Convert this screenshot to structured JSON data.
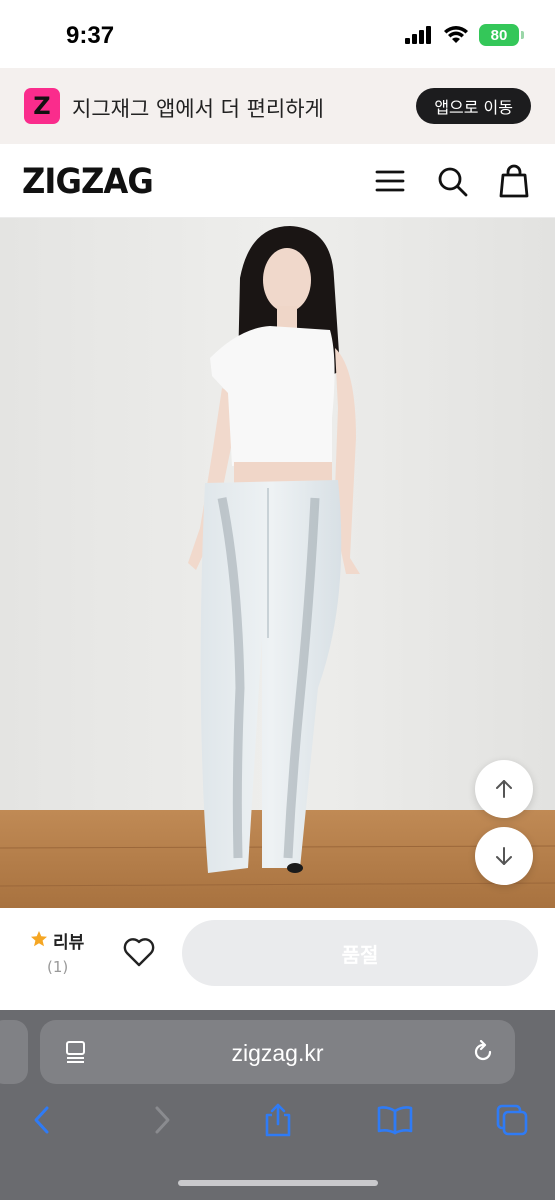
{
  "status_bar": {
    "time": "9:37",
    "battery": "80"
  },
  "app_banner": {
    "logo_letter": "Z",
    "text": "지그재그 앱에서 더 편리하게",
    "button_label": "앱으로 이동"
  },
  "header": {
    "logo": "ZIGZAG",
    "icons": [
      "menu-icon",
      "search-icon",
      "shopping-bag-icon"
    ]
  },
  "product": {
    "image": "fashion model photo",
    "scroll_buttons": [
      "arrow-up-icon",
      "arrow-down-icon"
    ]
  },
  "purchase_bar": {
    "review_label": "리뷰",
    "review_count": "(1)",
    "buy_button_label": "품절"
  },
  "browser": {
    "url": "zigzag.kr",
    "toolbar": [
      "back-icon",
      "forward-icon",
      "share-icon",
      "bookmarks-icon",
      "tabs-icon"
    ]
  },
  "colors": {
    "brand_pink": "#fa2c8c",
    "battery_green": "#34c759",
    "safari_blue": "#2f7bf5",
    "star": "#f5a623"
  }
}
